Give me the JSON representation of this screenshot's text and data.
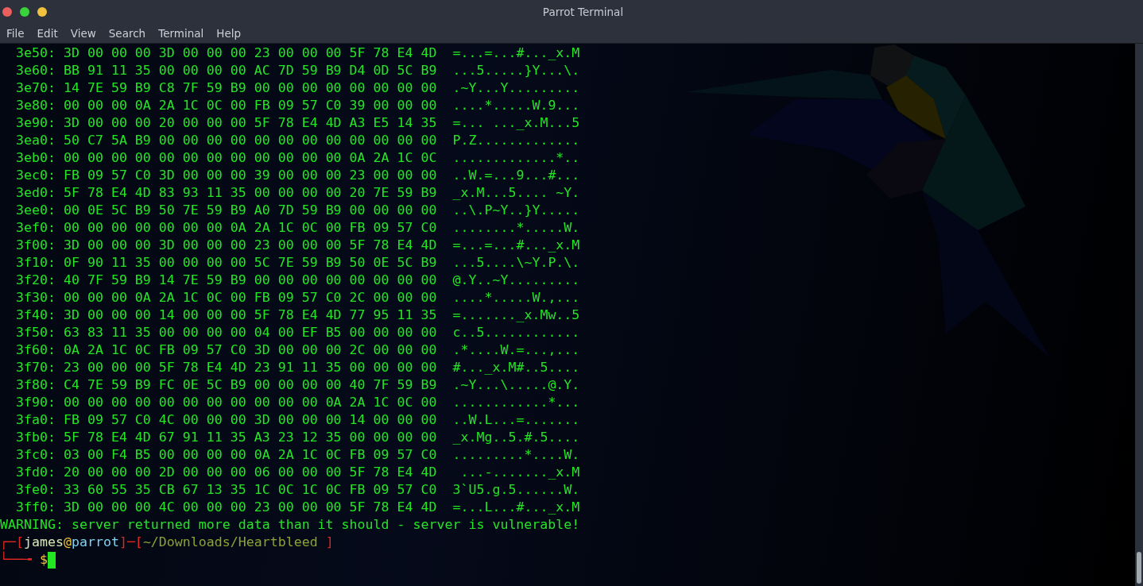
{
  "window": {
    "title": "Parrot Terminal"
  },
  "menu": [
    "File",
    "Edit",
    "View",
    "Search",
    "Terminal",
    "Help"
  ],
  "terminal": {
    "hex_rows": [
      {
        "offset": "3e50:",
        "hex": "3D 00 00 00 3D 00 00 00 23 00 00 00 5F 78 E4 4D",
        "ascii": "=...=...#..._x.M"
      },
      {
        "offset": "3e60:",
        "hex": "BB 91 11 35 00 00 00 00 AC 7D 59 B9 D4 0D 5C B9",
        "ascii": "...5.....}Y...\\."
      },
      {
        "offset": "3e70:",
        "hex": "14 7E 59 B9 C8 7F 59 B9 00 00 00 00 00 00 00 00",
        "ascii": ".~Y...Y........."
      },
      {
        "offset": "3e80:",
        "hex": "00 00 00 0A 2A 1C 0C 00 FB 09 57 C0 39 00 00 00",
        "ascii": "....*.....W.9..."
      },
      {
        "offset": "3e90:",
        "hex": "3D 00 00 00 20 00 00 00 5F 78 E4 4D A3 E5 14 35",
        "ascii": "=... ..._x.M...5"
      },
      {
        "offset": "3ea0:",
        "hex": "50 C7 5A B9 00 00 00 00 00 00 00 00 00 00 00 00",
        "ascii": "P.Z............."
      },
      {
        "offset": "3eb0:",
        "hex": "00 00 00 00 00 00 00 00 00 00 00 00 0A 2A 1C 0C",
        "ascii": ".............*.."
      },
      {
        "offset": "3ec0:",
        "hex": "FB 09 57 C0 3D 00 00 00 39 00 00 00 23 00 00 00",
        "ascii": "..W.=...9...#..."
      },
      {
        "offset": "3ed0:",
        "hex": "5F 78 E4 4D 83 93 11 35 00 00 00 00 20 7E 59 B9",
        "ascii": "_x.M...5.... ~Y."
      },
      {
        "offset": "3ee0:",
        "hex": "00 0E 5C B9 50 7E 59 B9 A0 7D 59 B9 00 00 00 00",
        "ascii": "..\\.P~Y..}Y....."
      },
      {
        "offset": "3ef0:",
        "hex": "00 00 00 00 00 00 00 0A 2A 1C 0C 00 FB 09 57 C0",
        "ascii": "........*.....W."
      },
      {
        "offset": "3f00:",
        "hex": "3D 00 00 00 3D 00 00 00 23 00 00 00 5F 78 E4 4D",
        "ascii": "=...=...#..._x.M"
      },
      {
        "offset": "3f10:",
        "hex": "0F 90 11 35 00 00 00 00 5C 7E 59 B9 50 0E 5C B9",
        "ascii": "...5....\\~Y.P.\\."
      },
      {
        "offset": "3f20:",
        "hex": "40 7F 59 B9 14 7E 59 B9 00 00 00 00 00 00 00 00",
        "ascii": "@.Y..~Y........."
      },
      {
        "offset": "3f30:",
        "hex": "00 00 00 0A 2A 1C 0C 00 FB 09 57 C0 2C 00 00 00",
        "ascii": "....*.....W.,..."
      },
      {
        "offset": "3f40:",
        "hex": "3D 00 00 00 14 00 00 00 5F 78 E4 4D 77 95 11 35",
        "ascii": "=......._x.Mw..5"
      },
      {
        "offset": "3f50:",
        "hex": "63 83 11 35 00 00 00 00 04 00 EF B5 00 00 00 00",
        "ascii": "c..5............"
      },
      {
        "offset": "3f60:",
        "hex": "0A 2A 1C 0C FB 09 57 C0 3D 00 00 00 2C 00 00 00",
        "ascii": ".*....W.=...,..."
      },
      {
        "offset": "3f70:",
        "hex": "23 00 00 00 5F 78 E4 4D 23 91 11 35 00 00 00 00",
        "ascii": "#..._x.M#..5...."
      },
      {
        "offset": "3f80:",
        "hex": "C4 7E 59 B9 FC 0E 5C B9 00 00 00 00 40 7F 59 B9",
        "ascii": ".~Y...\\.....@.Y."
      },
      {
        "offset": "3f90:",
        "hex": "00 00 00 00 00 00 00 00 00 00 00 0A 2A 1C 0C 00",
        "ascii": "............*..."
      },
      {
        "offset": "3fa0:",
        "hex": "FB 09 57 C0 4C 00 00 00 3D 00 00 00 14 00 00 00",
        "ascii": "..W.L...=......."
      },
      {
        "offset": "3fb0:",
        "hex": "5F 78 E4 4D 67 91 11 35 A3 23 12 35 00 00 00 00",
        "ascii": "_x.Mg..5.#.5...."
      },
      {
        "offset": "3fc0:",
        "hex": "03 00 F4 B5 00 00 00 00 0A 2A 1C 0C FB 09 57 C0",
        "ascii": ".........*....W."
      },
      {
        "offset": "3fd0:",
        "hex": "20 00 00 00 2D 00 00 00 06 00 00 00 5F 78 E4 4D",
        "ascii": " ...-......._x.M"
      },
      {
        "offset": "3fe0:",
        "hex": "33 60 55 35 CB 67 13 35 1C 0C 1C 0C FB 09 57 C0",
        "ascii": "3`U5.g.5......W."
      },
      {
        "offset": "3ff0:",
        "hex": "3D 00 00 00 4C 00 00 00 23 00 00 00 5F 78 E4 4D",
        "ascii": "=...L...#..._x.M"
      }
    ],
    "warning": "WARNING: server returned more data than it should - server is vulnerable!",
    "prompt": [
      {
        "kind": "frame",
        "text": "┌─["
      },
      {
        "kind": "user",
        "text": "james"
      },
      {
        "kind": "at",
        "text": "@"
      },
      {
        "kind": "host",
        "text": "parrot"
      },
      {
        "kind": "frame",
        "text": "]─["
      },
      {
        "kind": "path",
        "text": "~/Downloads/Heartbleed"
      },
      {
        "kind": "frame",
        "text": " ]"
      }
    ],
    "input_line": [
      {
        "kind": "frame",
        "text": "└──╼ "
      },
      {
        "kind": "symbol",
        "text": "$"
      }
    ],
    "cursor_visible": true
  }
}
